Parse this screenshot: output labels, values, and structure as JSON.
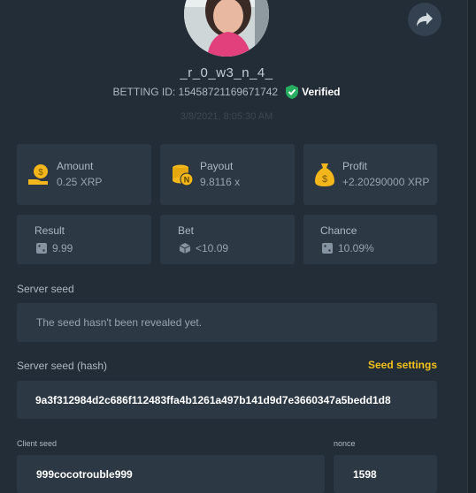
{
  "profile": {
    "username": "_r_0_w3_n_4_",
    "betting_id": "BETTING ID: 15458721169671742",
    "verified_label": "Verified",
    "timestamp": "3/8/2021, 8:05:30 AM"
  },
  "stats": {
    "amount": {
      "label": "Amount",
      "value": "0.25 XRP"
    },
    "payout": {
      "label": "Payout",
      "value": "9.8116 x"
    },
    "profit": {
      "label": "Profit",
      "value": "+2.20290000 XRP"
    },
    "result": {
      "label": "Result",
      "value": "9.99"
    },
    "bet": {
      "label": "Bet",
      "value": "<10.09"
    },
    "chance": {
      "label": "Chance",
      "value": "10.09%"
    }
  },
  "server_seed": {
    "label": "Server seed",
    "value": "The seed hasn't been revealed yet."
  },
  "server_seed_hash": {
    "label": "Server seed (hash)",
    "settings_label": "Seed settings",
    "value": "9a3f312984d2c686f112483ffa4b1261a497b141d9d7e3660347a5bedd1d8"
  },
  "client_seed": {
    "label": "Client seed",
    "value": "999cocotrouble999"
  },
  "nonce": {
    "label": "nonce",
    "value": "1598"
  },
  "colors": {
    "background": "#25303a",
    "card": "#2c3843",
    "accent_gold": "#f3c11b",
    "verified_green": "#27ae60"
  },
  "icons": [
    "share-icon",
    "verified-check-icon",
    "coin-hand-icon",
    "coin-stack-icon",
    "money-bag-icon",
    "dice-icon"
  ]
}
